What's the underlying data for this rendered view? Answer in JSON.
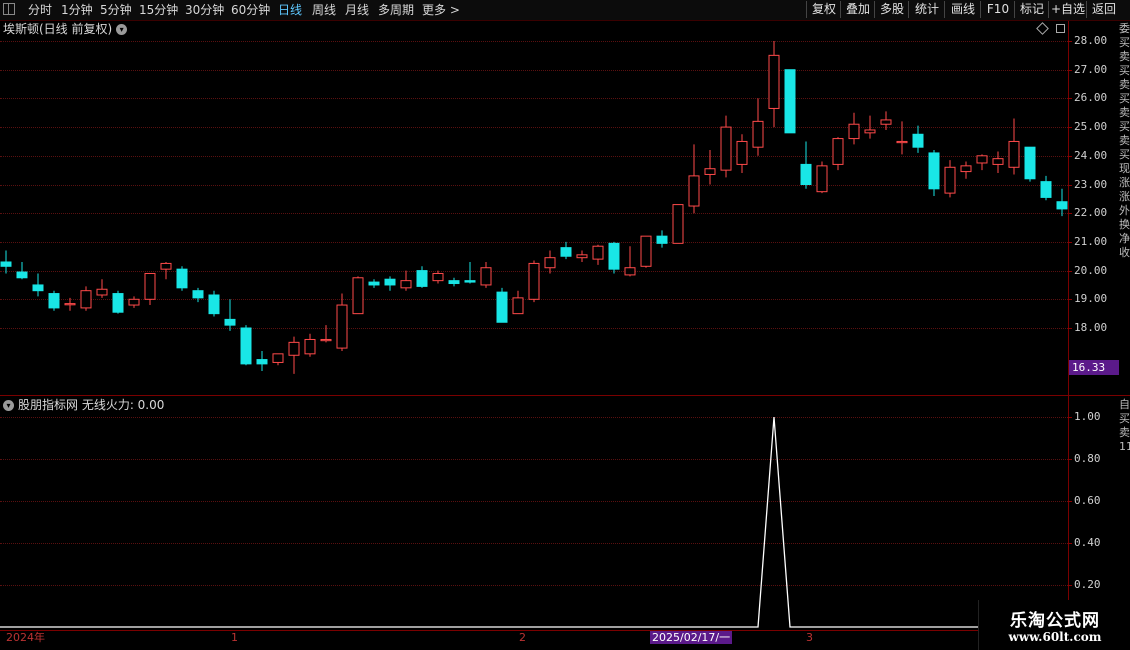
{
  "toolbar": {
    "periods": [
      "分时",
      "1分钟",
      "5分钟",
      "15分钟",
      "30分钟",
      "60分钟",
      "日线",
      "周线",
      "月线",
      "多周期",
      "更多 >"
    ],
    "active_period": "日线",
    "tools": [
      "复权",
      "叠加",
      "多股",
      "统计",
      "画线",
      "F10",
      "标记",
      "+自选",
      "返回"
    ]
  },
  "main_panel": {
    "title": "埃斯顿(日线 前复权)",
    "y_ticks": [
      "28.00",
      "27.00",
      "26.00",
      "25.00",
      "24.00",
      "23.00",
      "22.00",
      "21.00",
      "20.00",
      "19.00",
      "18.00"
    ],
    "price_tag": "16.33",
    "side_text": "委买卖买卖买卖买卖买现涨涨外换净收"
  },
  "indicator_panel": {
    "title": "股朋指标网 无线火力: 0.00",
    "y_ticks": [
      "1.00",
      "0.80",
      "0.60",
      "0.40",
      "0.20"
    ],
    "side_text": "自买卖1111111"
  },
  "x_axis": {
    "labels": [
      "2024年",
      "1",
      "2",
      "2025/02/17/一",
      "3"
    ]
  },
  "watermark": {
    "line1": "乐淘公式网",
    "line2": "www.60lt.com"
  },
  "colors": {
    "up": "#ff4a4a",
    "down": "#19e6e6",
    "indicator": "#ffffff",
    "grid": "#5a1010",
    "highlight": "#5b1a8a"
  },
  "chart_data": [
    {
      "type": "candlestick",
      "title": "埃斯顿(日线 前复权)",
      "ylim": [
        16.5,
        28.3
      ],
      "x_labels": [
        "2024年",
        "1",
        "2",
        "2025/02/17/一",
        "3"
      ],
      "candles": [
        {
          "o": 20.3,
          "h": 20.7,
          "l": 19.9,
          "c": 20.15
        },
        {
          "o": 19.95,
          "h": 20.3,
          "l": 19.7,
          "c": 19.75
        },
        {
          "o": 19.5,
          "h": 19.9,
          "l": 19.1,
          "c": 19.3
        },
        {
          "o": 19.2,
          "h": 19.3,
          "l": 18.6,
          "c": 18.7
        },
        {
          "o": 18.85,
          "h": 19.05,
          "l": 18.6,
          "c": 18.85
        },
        {
          "o": 18.7,
          "h": 19.45,
          "l": 18.6,
          "c": 19.3
        },
        {
          "o": 19.15,
          "h": 19.7,
          "l": 19.05,
          "c": 19.35
        },
        {
          "o": 19.2,
          "h": 19.3,
          "l": 18.5,
          "c": 18.55
        },
        {
          "o": 18.8,
          "h": 19.1,
          "l": 18.7,
          "c": 19.0
        },
        {
          "o": 19.0,
          "h": 19.9,
          "l": 18.8,
          "c": 19.9
        },
        {
          "o": 20.05,
          "h": 20.3,
          "l": 19.7,
          "c": 20.25
        },
        {
          "o": 20.05,
          "h": 20.15,
          "l": 19.3,
          "c": 19.4
        },
        {
          "o": 19.3,
          "h": 19.4,
          "l": 18.9,
          "c": 19.05
        },
        {
          "o": 19.15,
          "h": 19.3,
          "l": 18.4,
          "c": 18.5
        },
        {
          "o": 18.3,
          "h": 19.0,
          "l": 17.9,
          "c": 18.1
        },
        {
          "o": 18.0,
          "h": 18.1,
          "l": 16.7,
          "c": 16.75
        },
        {
          "o": 16.9,
          "h": 17.2,
          "l": 16.5,
          "c": 16.75
        },
        {
          "o": 16.8,
          "h": 17.1,
          "l": 16.7,
          "c": 17.1
        },
        {
          "o": 17.05,
          "h": 17.7,
          "l": 16.4,
          "c": 17.5
        },
        {
          "o": 17.1,
          "h": 17.8,
          "l": 17.0,
          "c": 17.6
        },
        {
          "o": 17.6,
          "h": 18.1,
          "l": 17.5,
          "c": 17.6
        },
        {
          "o": 17.3,
          "h": 19.2,
          "l": 17.2,
          "c": 18.8
        },
        {
          "o": 18.5,
          "h": 19.8,
          "l": 18.5,
          "c": 19.75
        },
        {
          "o": 19.6,
          "h": 19.7,
          "l": 19.4,
          "c": 19.5
        },
        {
          "o": 19.7,
          "h": 19.8,
          "l": 19.3,
          "c": 19.5
        },
        {
          "o": 19.4,
          "h": 20.0,
          "l": 19.3,
          "c": 19.65
        },
        {
          "o": 20.0,
          "h": 20.15,
          "l": 19.4,
          "c": 19.45
        },
        {
          "o": 19.65,
          "h": 20.0,
          "l": 19.55,
          "c": 19.9
        },
        {
          "o": 19.65,
          "h": 19.75,
          "l": 19.45,
          "c": 19.55
        },
        {
          "o": 19.65,
          "h": 20.3,
          "l": 19.55,
          "c": 19.6
        },
        {
          "o": 19.5,
          "h": 20.3,
          "l": 19.4,
          "c": 20.1
        },
        {
          "o": 19.25,
          "h": 19.4,
          "l": 18.2,
          "c": 18.2
        },
        {
          "o": 18.5,
          "h": 19.3,
          "l": 18.5,
          "c": 19.05
        },
        {
          "o": 19.0,
          "h": 20.35,
          "l": 18.9,
          "c": 20.25
        },
        {
          "o": 20.1,
          "h": 20.7,
          "l": 19.9,
          "c": 20.45
        },
        {
          "o": 20.8,
          "h": 21.0,
          "l": 20.4,
          "c": 20.5
        },
        {
          "o": 20.45,
          "h": 20.7,
          "l": 20.3,
          "c": 20.55
        },
        {
          "o": 20.4,
          "h": 20.9,
          "l": 20.2,
          "c": 20.85
        },
        {
          "o": 20.95,
          "h": 21.0,
          "l": 19.9,
          "c": 20.05
        },
        {
          "o": 19.85,
          "h": 20.85,
          "l": 19.8,
          "c": 20.1
        },
        {
          "o": 20.15,
          "h": 21.2,
          "l": 20.1,
          "c": 21.2
        },
        {
          "o": 21.2,
          "h": 21.4,
          "l": 20.8,
          "c": 20.95
        },
        {
          "o": 20.95,
          "h": 22.3,
          "l": 20.95,
          "c": 22.3
        },
        {
          "o": 22.25,
          "h": 24.4,
          "l": 22.0,
          "c": 23.3
        },
        {
          "o": 23.35,
          "h": 24.2,
          "l": 23.0,
          "c": 23.55
        },
        {
          "o": 23.5,
          "h": 25.4,
          "l": 23.25,
          "c": 25.0
        },
        {
          "o": 23.7,
          "h": 24.75,
          "l": 23.4,
          "c": 24.5
        },
        {
          "o": 24.3,
          "h": 26.0,
          "l": 24.0,
          "c": 25.2
        },
        {
          "o": 25.65,
          "h": 28.0,
          "l": 25.0,
          "c": 27.5
        },
        {
          "o": 27.0,
          "h": 27.0,
          "l": 24.8,
          "c": 24.8
        },
        {
          "o": 23.7,
          "h": 24.5,
          "l": 22.85,
          "c": 23.0
        },
        {
          "o": 22.75,
          "h": 23.8,
          "l": 22.7,
          "c": 23.65
        },
        {
          "o": 23.7,
          "h": 24.65,
          "l": 23.5,
          "c": 24.6
        },
        {
          "o": 24.6,
          "h": 25.5,
          "l": 24.4,
          "c": 25.1
        },
        {
          "o": 24.8,
          "h": 25.4,
          "l": 24.6,
          "c": 24.9
        },
        {
          "o": 25.1,
          "h": 25.55,
          "l": 24.9,
          "c": 25.25
        },
        {
          "o": 24.5,
          "h": 25.2,
          "l": 24.05,
          "c": 24.5
        },
        {
          "o": 24.75,
          "h": 25.05,
          "l": 24.1,
          "c": 24.3
        },
        {
          "o": 24.1,
          "h": 24.2,
          "l": 22.6,
          "c": 22.85
        },
        {
          "o": 22.7,
          "h": 23.85,
          "l": 22.55,
          "c": 23.6
        },
        {
          "o": 23.45,
          "h": 23.8,
          "l": 23.2,
          "c": 23.65
        },
        {
          "o": 23.75,
          "h": 24.05,
          "l": 23.5,
          "c": 24.0
        },
        {
          "o": 23.7,
          "h": 24.15,
          "l": 23.4,
          "c": 23.9
        },
        {
          "o": 23.6,
          "h": 25.3,
          "l": 23.35,
          "c": 24.5
        },
        {
          "o": 24.3,
          "h": 24.3,
          "l": 23.1,
          "c": 23.2
        },
        {
          "o": 23.1,
          "h": 23.3,
          "l": 22.45,
          "c": 22.55
        },
        {
          "o": 22.4,
          "h": 22.85,
          "l": 21.9,
          "c": 22.15
        }
      ]
    },
    {
      "type": "line",
      "title": "股朋指标网 无线火力: 0.00",
      "ylim": [
        0,
        1.0
      ],
      "y_ticks": [
        1.0,
        0.8,
        0.6,
        0.4,
        0.2
      ],
      "series": [
        {
          "values": [
            0,
            0,
            0,
            0,
            0,
            0,
            0,
            0,
            0,
            0,
            0,
            0,
            0,
            0,
            0,
            0,
            0,
            0,
            0,
            0,
            0,
            0,
            0,
            0,
            0,
            0,
            0,
            0,
            0,
            0,
            0,
            0,
            0,
            0,
            0,
            0,
            0,
            0,
            0,
            0,
            0,
            0,
            0,
            0,
            0,
            0,
            0,
            0,
            1,
            0,
            0,
            0,
            0,
            0,
            0,
            0,
            0,
            0,
            0,
            0,
            0,
            0,
            0,
            0,
            0,
            0,
            0
          ]
        }
      ]
    }
  ]
}
